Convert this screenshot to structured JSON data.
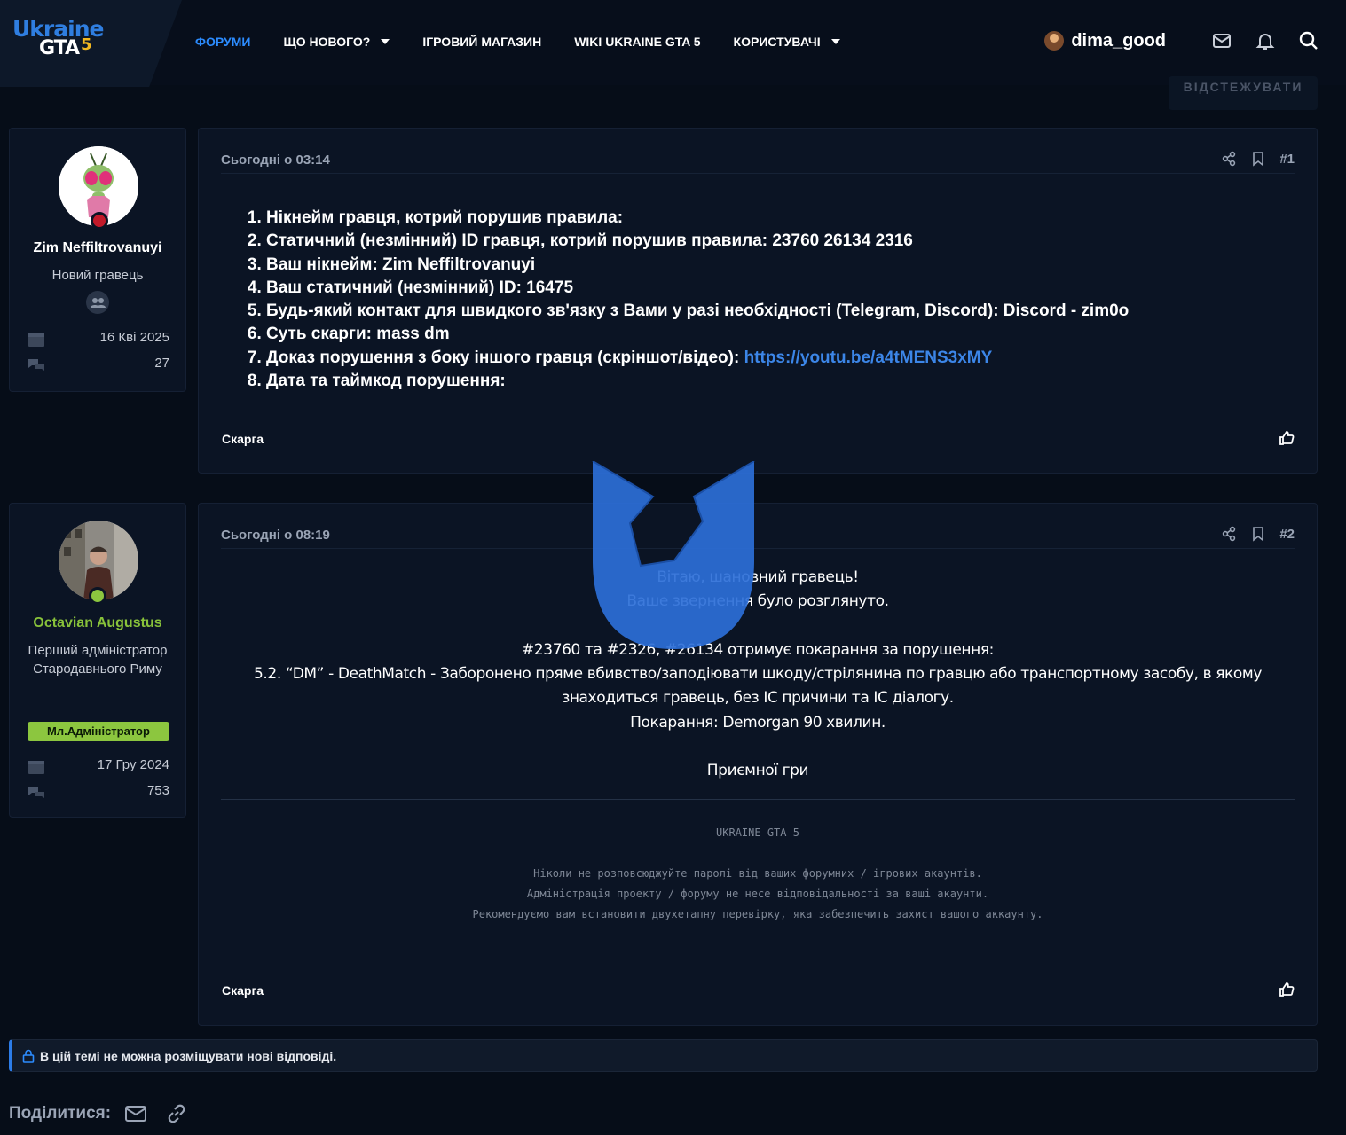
{
  "header": {
    "logo": {
      "line1": "Ukraine",
      "line2": "GTA",
      "line3": "5"
    },
    "nav": [
      {
        "label": "ФОРУМИ",
        "active": true,
        "has_dropdown": false
      },
      {
        "label": "ЩО НОВОГО?",
        "active": false,
        "has_dropdown": true
      },
      {
        "label": "ІГРОВИЙ МАГАЗИН",
        "active": false,
        "has_dropdown": false
      },
      {
        "label": "WIKI UKRAINE GTA 5",
        "active": false,
        "has_dropdown": false
      },
      {
        "label": "КОРИСТУВАЧІ",
        "active": false,
        "has_dropdown": true
      }
    ],
    "username": "dima_good",
    "icons": [
      "envelope-icon",
      "bell-icon",
      "search-icon"
    ],
    "follow_label": "ВІДСТЕЖУВАТИ"
  },
  "posts": [
    {
      "author": {
        "name": "Zim Neffiltrovanuyi",
        "title": "Новий гравець",
        "joined": "16 Кві 2025",
        "messages": "27"
      },
      "date": "Сьогодні о 03:14",
      "number": "#1",
      "items": [
        "Нікнейм гравця, котрий порушив правила:",
        "Статичний (незмінний) ID гравця, котрий порушив правила: 23760 26134 2316",
        "Ваш нікнейм: Zim Neffiltrovanuyi",
        "Ваш статичний (незмінний) ID: 16475",
        {
          "before": "Будь-який контакт для швидкого зв'язку з Вами у разі необхідності (",
          "underlined": "Telegram",
          "after": ", Discord): Discord - zim0o"
        },
        "Суть скарги: mass dm",
        {
          "before": "Доказ порушення з боку іншого гравця (скріншот/відео): ",
          "link": "https://youtu.be/a4tMENS3xMY"
        },
        "Дата та таймкод порушення:"
      ],
      "report_label": "Скарга"
    },
    {
      "author": {
        "name": "Octavian Augustus",
        "title": "Перший адміністратор Стародавнього Риму",
        "badge": "Мл.Адміністратор",
        "joined": "17 Гру 2024",
        "messages": "753"
      },
      "date": "Сьогодні о 08:19",
      "number": "#2",
      "greeting": "Вітаю, шановний гравець!",
      "status": "Ваше звернення було розглянуто.",
      "verdict": "#23760 та #2326, #26134 отримує покарання за порушення:",
      "rule_line1": "5.2. “DM” - DeathMatch - Заборонено пряме вбивство/заподіювати шкоду/стрілянина по гравцю або транспортному засобу, в якому",
      "rule_line2": "знаходиться гравець, без IC причини та IC діалогу.",
      "punishment": "Покарання: Demorgan 90 хвилин.",
      "closing": "Приємної гри",
      "signature": {
        "brand": "UKRAINE GTA 5",
        "line1": "Ніколи не розповсюджуйте паролі від ваших форумних / ігрових акаунтів.",
        "line2": "Адміністрація проекту / форуму не несе відповідальності за ваші акаунти.",
        "line3": "Рекомендуємо вам встановити двухетапну перевірку, яка забезпечить захист вашого аккаунту."
      },
      "report_label": "Скарга"
    }
  ],
  "locked_notice": "В цій темі не можна розміщувати нові відповіді.",
  "share": {
    "label": "Поділитися:",
    "icons": [
      "envelope-icon",
      "link-icon"
    ]
  },
  "colors": {
    "background": "#060d18",
    "panel": "#0b1424",
    "accent": "#2c8cff",
    "admin_green": "#8cc63f",
    "link": "#3c86e8"
  }
}
